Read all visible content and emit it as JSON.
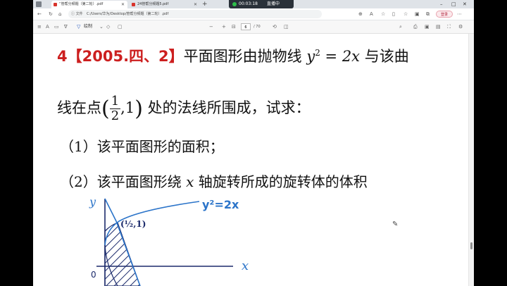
{
  "browser": {
    "tabs": [
      {
        "label": "“管帮分频题（第二轮）.pdf"
      },
      {
        "label": "24管帮分频题5.pdf"
      }
    ],
    "new_tab": "+",
    "recording": {
      "time": "00:03:18",
      "label": "直播中"
    },
    "address": {
      "file_label": "ⓘ 文件",
      "url": "C:/Users/华为/Desktop/管帮分频题（第二轮）.pdf"
    },
    "login_label": "登录",
    "window_controls": {
      "minimize": "–",
      "maximize": "□",
      "close": "✕"
    }
  },
  "pdf_toolbar": {
    "draw_label": "绘制",
    "zoom_out": "−",
    "zoom_in": "+",
    "page_current": "6",
    "page_total": "/ 70"
  },
  "document": {
    "line1": {
      "number": "4",
      "tag": "【2005.四、2】",
      "text_a": "平面图形由抛物线 ",
      "math_y": "y",
      "exp": "2",
      "math_rest": " = 2x",
      "text_b": " 与该曲"
    },
    "line2": {
      "text_a": "线在点",
      "paren_open": "(",
      "frac_num": "1",
      "frac_den": "2",
      "coord_rest": ",1",
      "paren_close": ")",
      "text_b": " 处的法线所围成，试求："
    },
    "line3": "（1）该平面图形的面积；",
    "line4": {
      "text_a": "（2）该平面图形绕 ",
      "math_x": "x",
      "text_b": " 轴旋转所成的旋转体的体积"
    }
  },
  "handwriting": {
    "y_axis": "y",
    "x_axis": "x",
    "origin": "0",
    "curve_label": "y²=2x",
    "point_label": "(½,1)",
    "ink_color": "#2b74c9"
  }
}
